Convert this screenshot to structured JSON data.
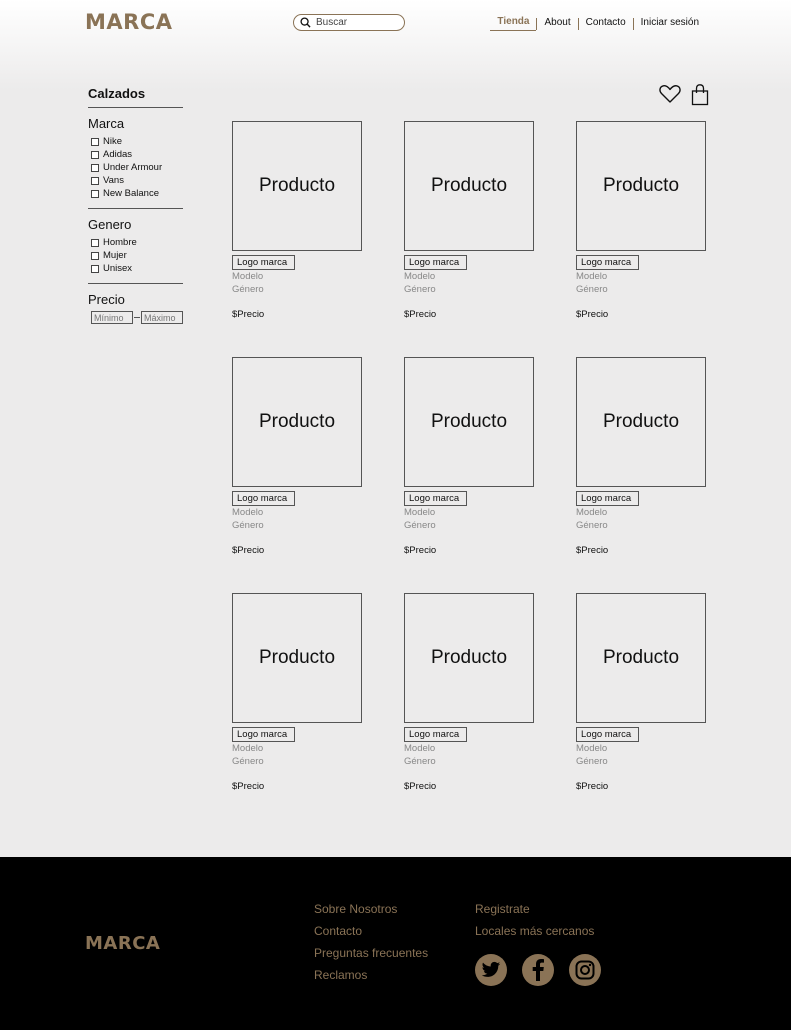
{
  "header": {
    "logo": "MARCA",
    "search": {
      "placeholder": "Buscar",
      "icon": "search-icon"
    },
    "nav": [
      {
        "label": "Tienda",
        "active": true
      },
      {
        "label": "About",
        "active": false
      },
      {
        "label": "Contacto",
        "active": false
      },
      {
        "label": "Iniciar sesión",
        "active": false
      }
    ]
  },
  "sidebar": {
    "title": "Calzados",
    "marca": {
      "title": "Marca",
      "options": [
        "Nike",
        "Adidas",
        "Under Armour",
        "Vans",
        "New Balance"
      ]
    },
    "genero": {
      "title": "Genero",
      "options": [
        "Hombre",
        "Mujer",
        "Unisex"
      ]
    },
    "precio": {
      "title": "Precio",
      "min_placeholder": "Mínimo",
      "max_placeholder": "Máximo"
    }
  },
  "icons": {
    "favorites": "heart-icon",
    "cart": "shopping-bag-icon"
  },
  "products": [
    {
      "image_label": "Producto",
      "brand_logo": "Logo marca",
      "model": "Modelo",
      "gender": "Género",
      "price": "$Precio"
    },
    {
      "image_label": "Producto",
      "brand_logo": "Logo marca",
      "model": "Modelo",
      "gender": "Género",
      "price": "$Precio"
    },
    {
      "image_label": "Producto",
      "brand_logo": "Logo marca",
      "model": "Modelo",
      "gender": "Género",
      "price": "$Precio"
    },
    {
      "image_label": "Producto",
      "brand_logo": "Logo marca",
      "model": "Modelo",
      "gender": "Género",
      "price": "$Precio"
    },
    {
      "image_label": "Producto",
      "brand_logo": "Logo marca",
      "model": "Modelo",
      "gender": "Género",
      "price": "$Precio"
    },
    {
      "image_label": "Producto",
      "brand_logo": "Logo marca",
      "model": "Modelo",
      "gender": "Género",
      "price": "$Precio"
    },
    {
      "image_label": "Producto",
      "brand_logo": "Logo marca",
      "model": "Modelo",
      "gender": "Género",
      "price": "$Precio"
    },
    {
      "image_label": "Producto",
      "brand_logo": "Logo marca",
      "model": "Modelo",
      "gender": "Género",
      "price": "$Precio"
    },
    {
      "image_label": "Producto",
      "brand_logo": "Logo marca",
      "model": "Modelo",
      "gender": "Género",
      "price": "$Precio"
    }
  ],
  "footer": {
    "logo": "MARCA",
    "col1": [
      "Sobre Nosotros",
      "Contacto",
      "Preguntas frecuentes",
      "Reclamos"
    ],
    "col2": [
      "Registrate",
      "Locales más cercanos"
    ],
    "socials": [
      "twitter-icon",
      "facebook-icon",
      "instagram-icon"
    ]
  },
  "colors": {
    "accent": "#8a7356",
    "background": "#ecebeb",
    "footer": "#000000"
  }
}
